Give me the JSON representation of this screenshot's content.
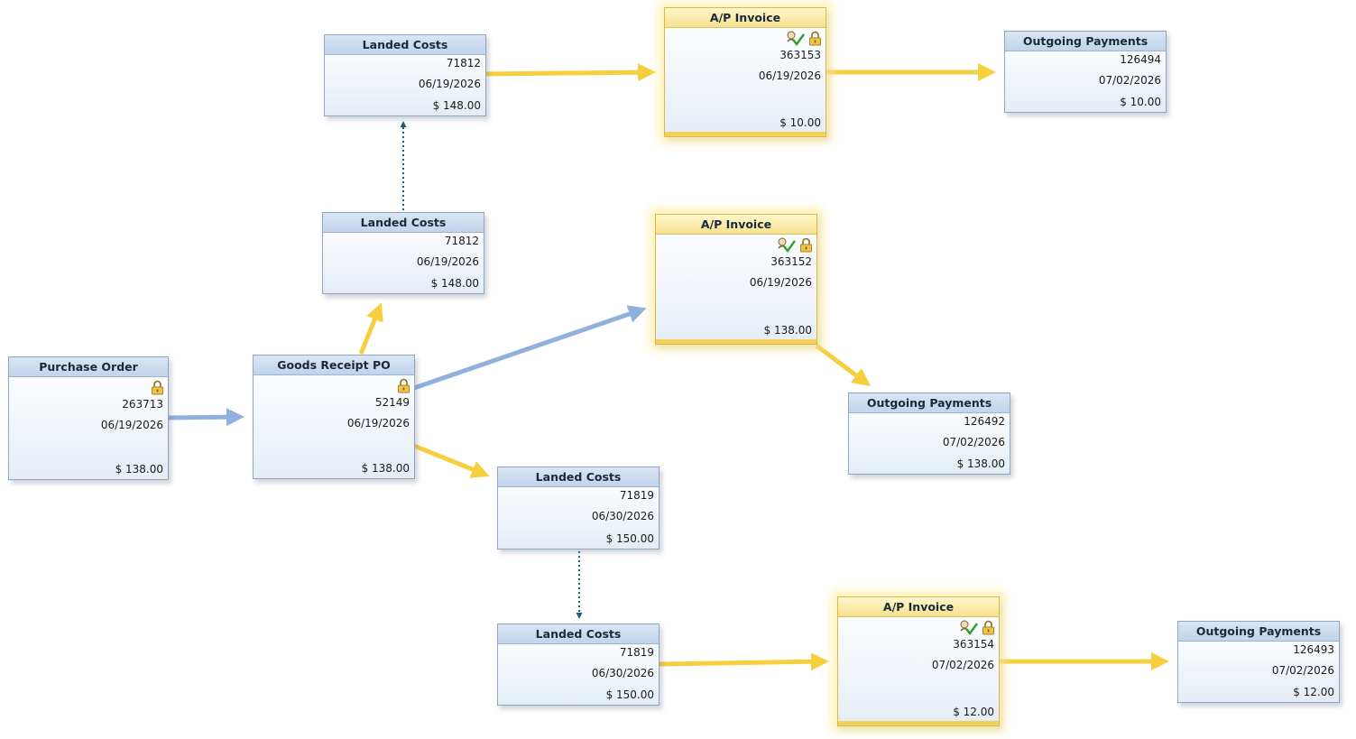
{
  "colors": {
    "arrow_gold": "#f5cf3d",
    "arrow_blue": "#8fb1dc",
    "dotted_teal": "#1f5f78"
  },
  "icons": [
    "lock-icon",
    "payment-check-icon"
  ],
  "nodes": {
    "po": {
      "title": "Purchase Order",
      "number": "263713",
      "date": "06/19/2026",
      "amount": "$ 138.00"
    },
    "grpo": {
      "title": "Goods Receipt PO",
      "number": "52149",
      "date": "06/19/2026",
      "amount": "$ 138.00"
    },
    "lc_top": {
      "title": "Landed Costs",
      "number": "71812",
      "date": "06/19/2026",
      "amount": "$ 148.00"
    },
    "lc_mid": {
      "title": "Landed Costs",
      "number": "71812",
      "date": "06/19/2026",
      "amount": "$ 148.00"
    },
    "lc_low1": {
      "title": "Landed Costs",
      "number": "71819",
      "date": "06/30/2026",
      "amount": "$ 150.00"
    },
    "lc_low2": {
      "title": "Landed Costs",
      "number": "71819",
      "date": "06/30/2026",
      "amount": "$ 150.00"
    },
    "ap1": {
      "title": "A/P Invoice",
      "number": "363153",
      "date": "06/19/2026",
      "amount": "$ 10.00"
    },
    "ap2": {
      "title": "A/P Invoice",
      "number": "363152",
      "date": "06/19/2026",
      "amount": "$ 138.00"
    },
    "ap3": {
      "title": "A/P Invoice",
      "number": "363154",
      "date": "07/02/2026",
      "amount": "$ 12.00"
    },
    "op1": {
      "title": "Outgoing Payments",
      "number": "126494",
      "date": "07/02/2026",
      "amount": "$ 10.00"
    },
    "op2": {
      "title": "Outgoing Payments",
      "number": "126492",
      "date": "07/02/2026",
      "amount": "$ 138.00"
    },
    "op3": {
      "title": "Outgoing Payments",
      "number": "126493",
      "date": "07/02/2026",
      "amount": "$ 12.00"
    }
  }
}
